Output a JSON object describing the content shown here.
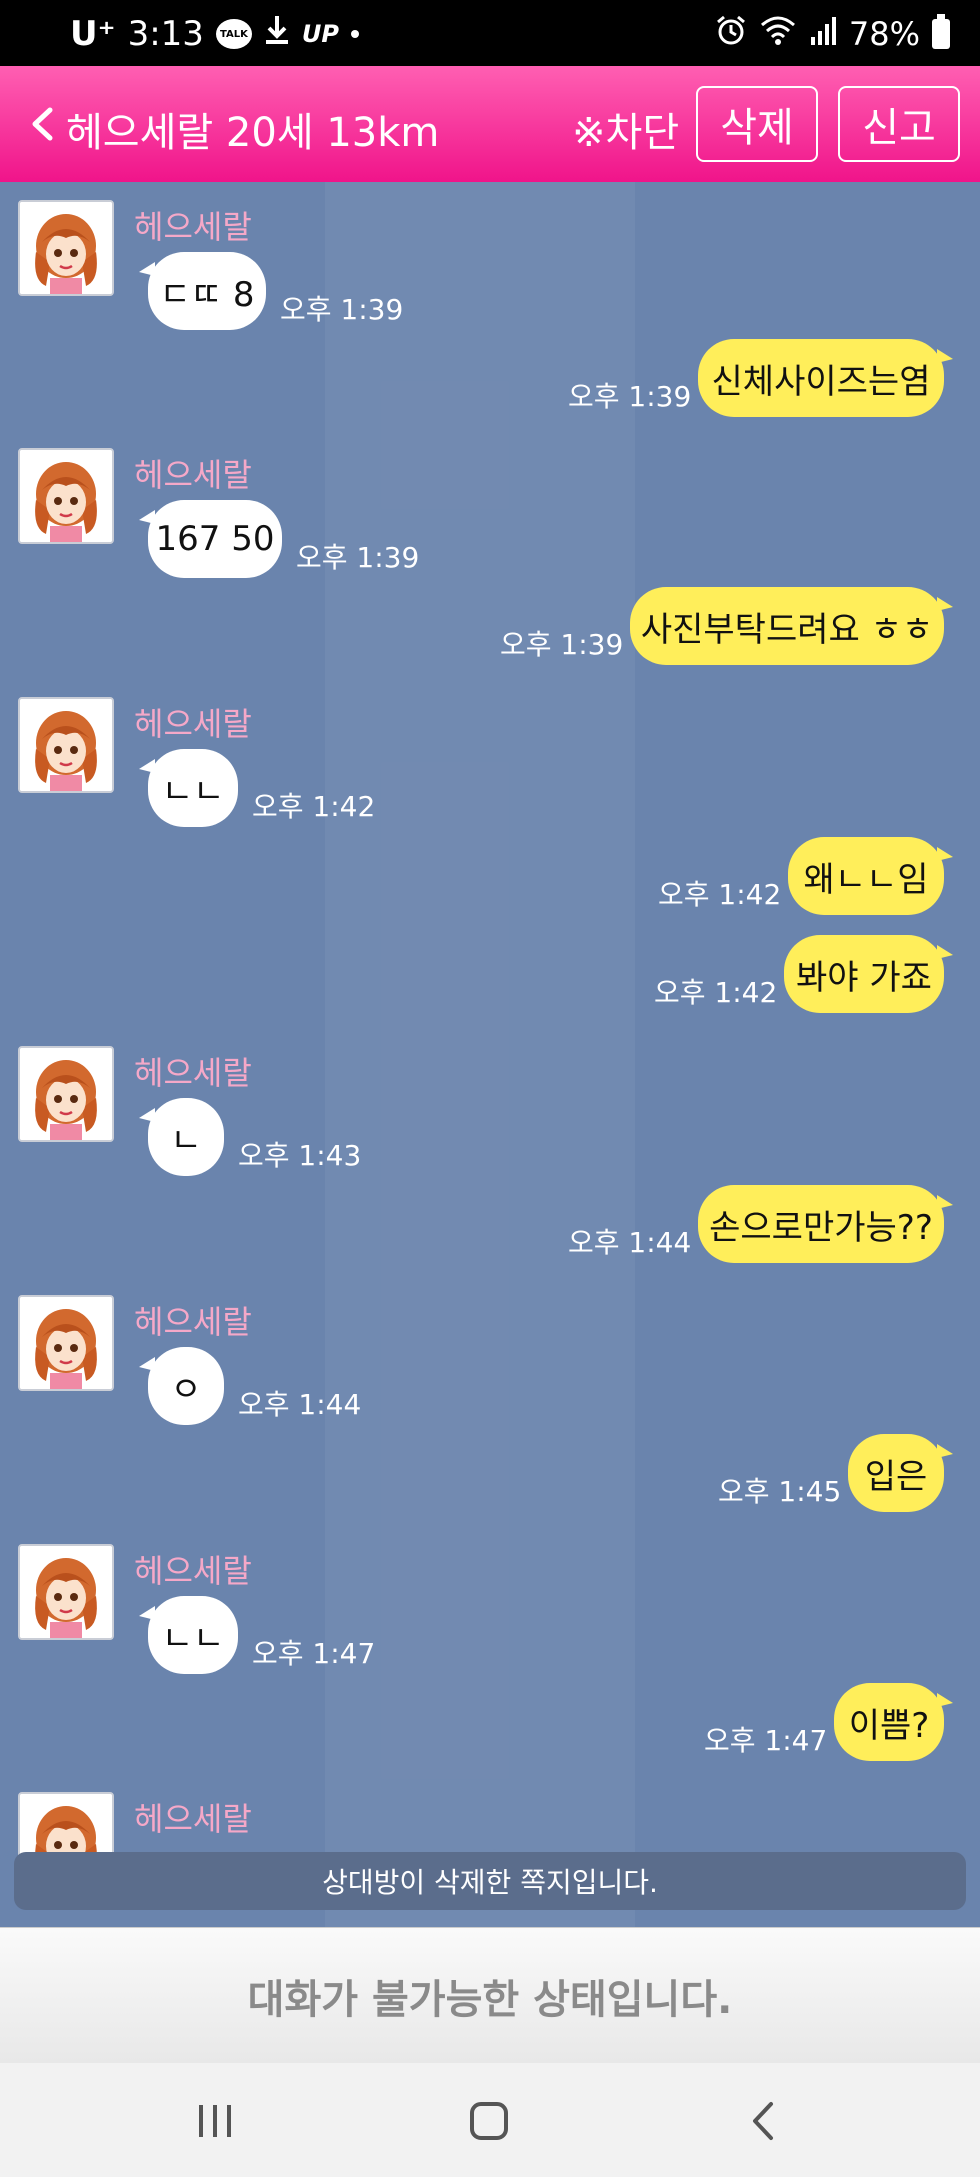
{
  "status_bar": {
    "carrier": "U⁺",
    "time": "3:13",
    "talk_badge": "TALK",
    "up_badge": "UP",
    "battery": "78%"
  },
  "header": {
    "title": "헤으세랄 20세 13km",
    "block_label": "※차단",
    "delete_label": "삭제",
    "report_label": "신고",
    "accent_color": "#f0148a"
  },
  "messages": [
    {
      "dir": "in",
      "sender": "헤으세랄",
      "text": "ㄷㄸ 8",
      "time": "오후 1:39"
    },
    {
      "dir": "out",
      "text": "신체사이즈는염",
      "time": "오후 1:39"
    },
    {
      "dir": "in",
      "sender": "헤으세랄",
      "text": "167 50",
      "time": "오후 1:39"
    },
    {
      "dir": "out",
      "text": "사진부탁드려요 ㅎㅎ",
      "time": "오후 1:39"
    },
    {
      "dir": "in",
      "sender": "헤으세랄",
      "text": "ㄴㄴ",
      "time": "오후 1:42"
    },
    {
      "dir": "out",
      "text": "왜ㄴㄴ임",
      "time": "오후 1:42"
    },
    {
      "dir": "out",
      "text": "봐야 가죠",
      "time": "오후 1:42"
    },
    {
      "dir": "in",
      "sender": "헤으세랄",
      "text": "ㄴ",
      "time": "오후 1:43"
    },
    {
      "dir": "out",
      "text": "손으로만가능??",
      "time": "오후 1:44"
    },
    {
      "dir": "in",
      "sender": "헤으세랄",
      "text": "ㅇ",
      "time": "오후 1:44"
    },
    {
      "dir": "out",
      "text": "입은",
      "time": "오후 1:45"
    },
    {
      "dir": "in",
      "sender": "헤으세랄",
      "text": "ㄴㄴ",
      "time": "오후 1:47"
    },
    {
      "dir": "out",
      "text": "이쁨?",
      "time": "오후 1:47"
    },
    {
      "dir": "in",
      "sender": "헤으세랄"
    }
  ],
  "notice": "상대방이 삭제한 쪽지입니다.",
  "input_disabled_text": "대화가 불가능한 상태입니다.",
  "icons": {
    "back": "chevron-left-icon",
    "nav_recents": "recents-icon",
    "nav_home": "home-icon",
    "nav_back": "back-icon"
  }
}
